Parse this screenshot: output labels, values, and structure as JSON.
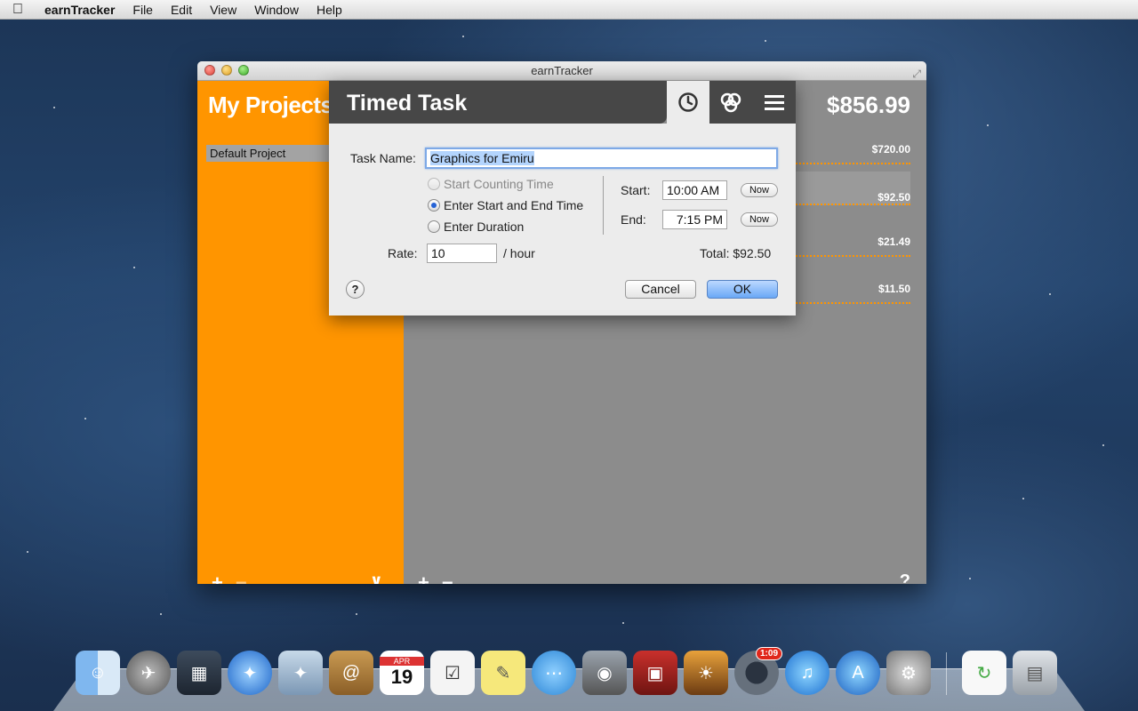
{
  "menubar": {
    "app": "earnTracker",
    "items": [
      "File",
      "Edit",
      "View",
      "Window",
      "Help"
    ]
  },
  "window": {
    "title": "earnTracker"
  },
  "sidebar": {
    "title": "My Projects",
    "project": "Default Project"
  },
  "main": {
    "total": "$856.99",
    "entries": [
      "$720.00",
      "$92.50",
      "$21.49",
      "$11.50"
    ]
  },
  "dialog": {
    "title": "Timed Task",
    "task_name_label": "Task Name:",
    "task_name_value": "Graphics for Emiru",
    "option_start_counting": "Start Counting Time",
    "option_enter_start_end": "Enter Start and End Time",
    "option_enter_duration": "Enter Duration",
    "start_label": "Start:",
    "start_value": "10:00 AM",
    "end_label": "End:",
    "end_value": "7:15 PM",
    "now_label": "Now",
    "rate_label": "Rate:",
    "rate_value": "10",
    "rate_unit": "/ hour",
    "total_label": "Total: $92.50",
    "help": "?",
    "cancel": "Cancel",
    "ok": "OK"
  },
  "dock": {
    "calendar_month": "APR",
    "calendar_day": "19",
    "badge": "1:09"
  },
  "colors": {
    "accent_orange": "#ff9500",
    "dialog_header": "#474747",
    "list_gray": "#8c8c8c"
  }
}
